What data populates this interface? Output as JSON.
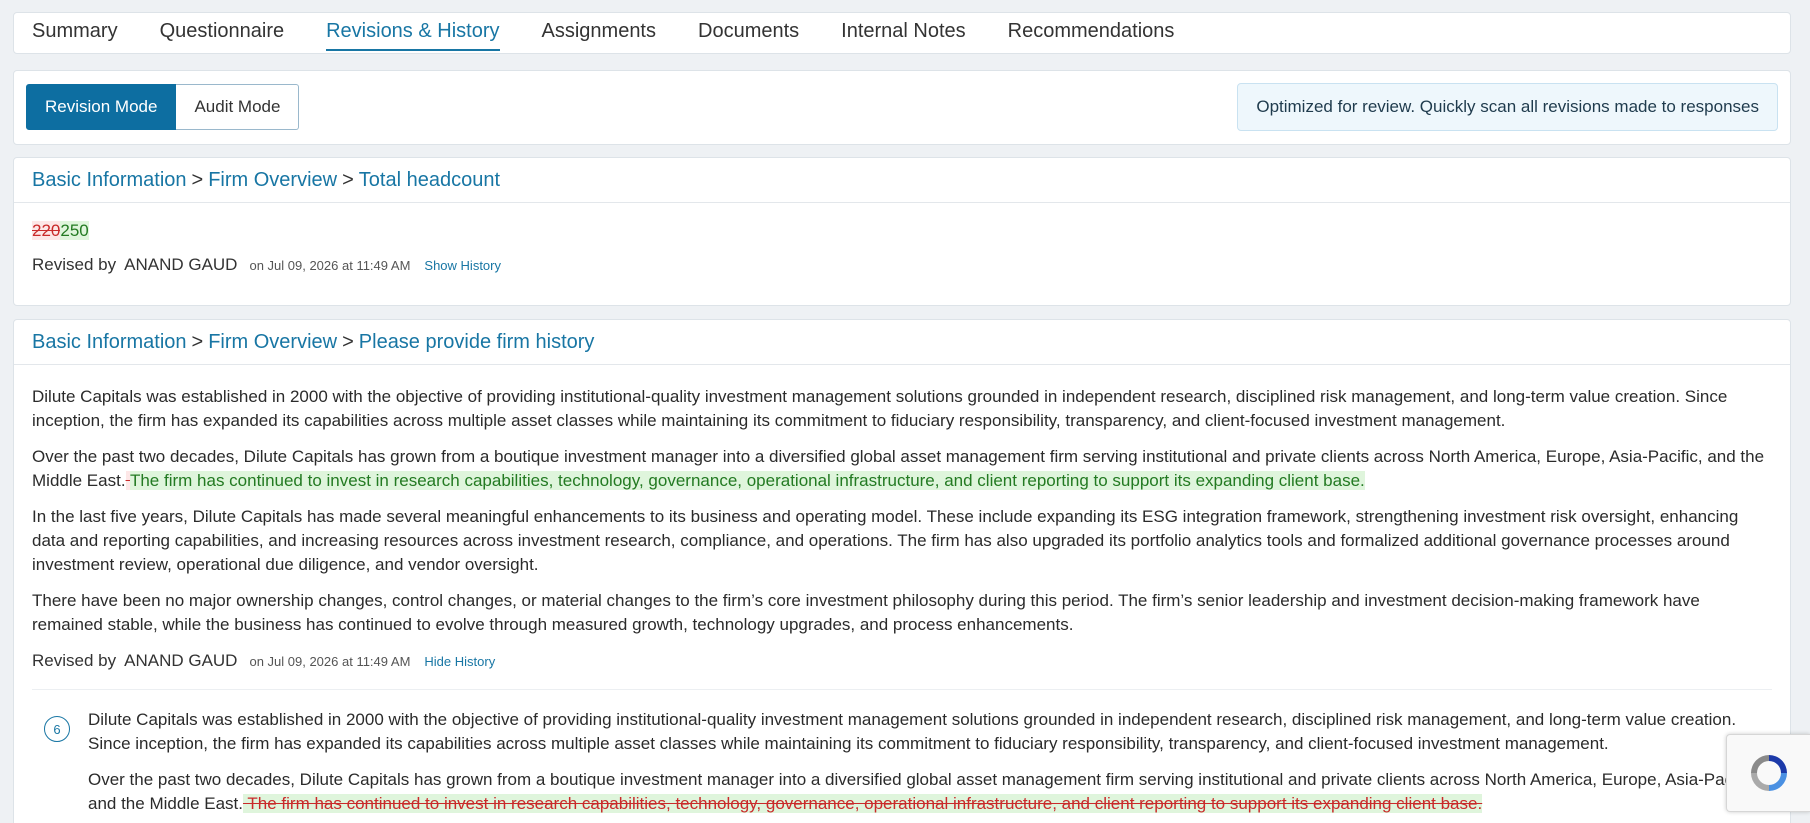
{
  "tabs": [
    {
      "label": "Summary",
      "active": false
    },
    {
      "label": "Questionnaire",
      "active": false
    },
    {
      "label": "Revisions & History",
      "active": true
    },
    {
      "label": "Assignments",
      "active": false
    },
    {
      "label": "Documents",
      "active": false
    },
    {
      "label": "Internal Notes",
      "active": false
    },
    {
      "label": "Recommendations",
      "active": false
    }
  ],
  "modes": {
    "revision_label": "Revision Mode",
    "audit_label": "Audit Mode",
    "note": "Optimized for review. Quickly scan all revisions made to responses"
  },
  "revisions": [
    {
      "crumbs": [
        "Basic Information",
        "Firm Overview",
        "Total headcount"
      ],
      "old_value": "220",
      "new_value": "250",
      "revised_by_label": "Revised by",
      "revised_by": "ANAND GAUD",
      "revised_on": "on Jul 09, 2026 at 11:49 AM",
      "toggle_label": "Show History"
    },
    {
      "crumbs": [
        "Basic Information",
        "Firm Overview",
        "Please provide firm history"
      ],
      "p1": "Dilute Capitals was established in 2000 with the objective of providing institutional-quality investment management solutions grounded in independent research, disciplined risk management, and long-term value creation. Since inception, the firm has expanded its capabilities across multiple asset classes while maintaining its commitment to fiduciary responsibility, transparency, and client-focused investment management.",
      "p2_base": "Over the past two decades, Dilute Capitals has grown from a boutique investment manager into a diversified global asset management firm serving institutional and private clients across North America, Europe, Asia-Pacific, and the Middle East.",
      "p2_removed": " ",
      "p2_added": "The firm has continued to invest in research capabilities, technology, governance, operational infrastructure, and client reporting to support its expanding client base.",
      "p3": "In the last five years, Dilute Capitals has made several meaningful enhancements to its business and operating model. These include expanding its ESG integration framework, strengthening investment risk oversight, enhancing data and reporting capabilities, and increasing resources across investment research, compliance, and operations.  The firm has also upgraded its portfolio analytics tools and formalized additional governance processes around investment review, operational due diligence, and vendor oversight.",
      "p4": "There have been no major ownership changes, control changes, or material changes to the firm’s core investment philosophy during this period. The firm’s senior leadership and investment decision-making framework have remained stable, while the business has continued to evolve through measured growth, technology upgrades, and process enhancements.",
      "revised_by_label": "Revised by",
      "revised_by": "ANAND GAUD",
      "revised_on": "on Jul 09, 2026 at 11:49 AM",
      "toggle_label": "Hide History",
      "history": {
        "version": "6",
        "p1": "Dilute Capitals was established in 2000 with the objective of providing institutional-quality investment management solutions grounded in independent research, disciplined risk management, and long-term value creation. Since inception, the firm has expanded its capabilities across multiple asset classes while maintaining its commitment to fiduciary responsibility, transparency, and client-focused investment management.",
        "p2_base": "Over the past two decades, Dilute Capitals has grown from a boutique investment manager into a diversified global asset management firm serving institutional and private clients across North America, Europe, Asia-Pacific, and the Middle East.",
        "p2_removed": " The firm has continued to invest in research capabilities, technology, governance, operational infrastructure, and client reporting to support its expanding client base."
      }
    }
  ],
  "colors": {
    "accent": "#1876a4",
    "primary_button": "#0d6ea1",
    "deleted": "#c92a2a",
    "inserted": "#237a22"
  }
}
